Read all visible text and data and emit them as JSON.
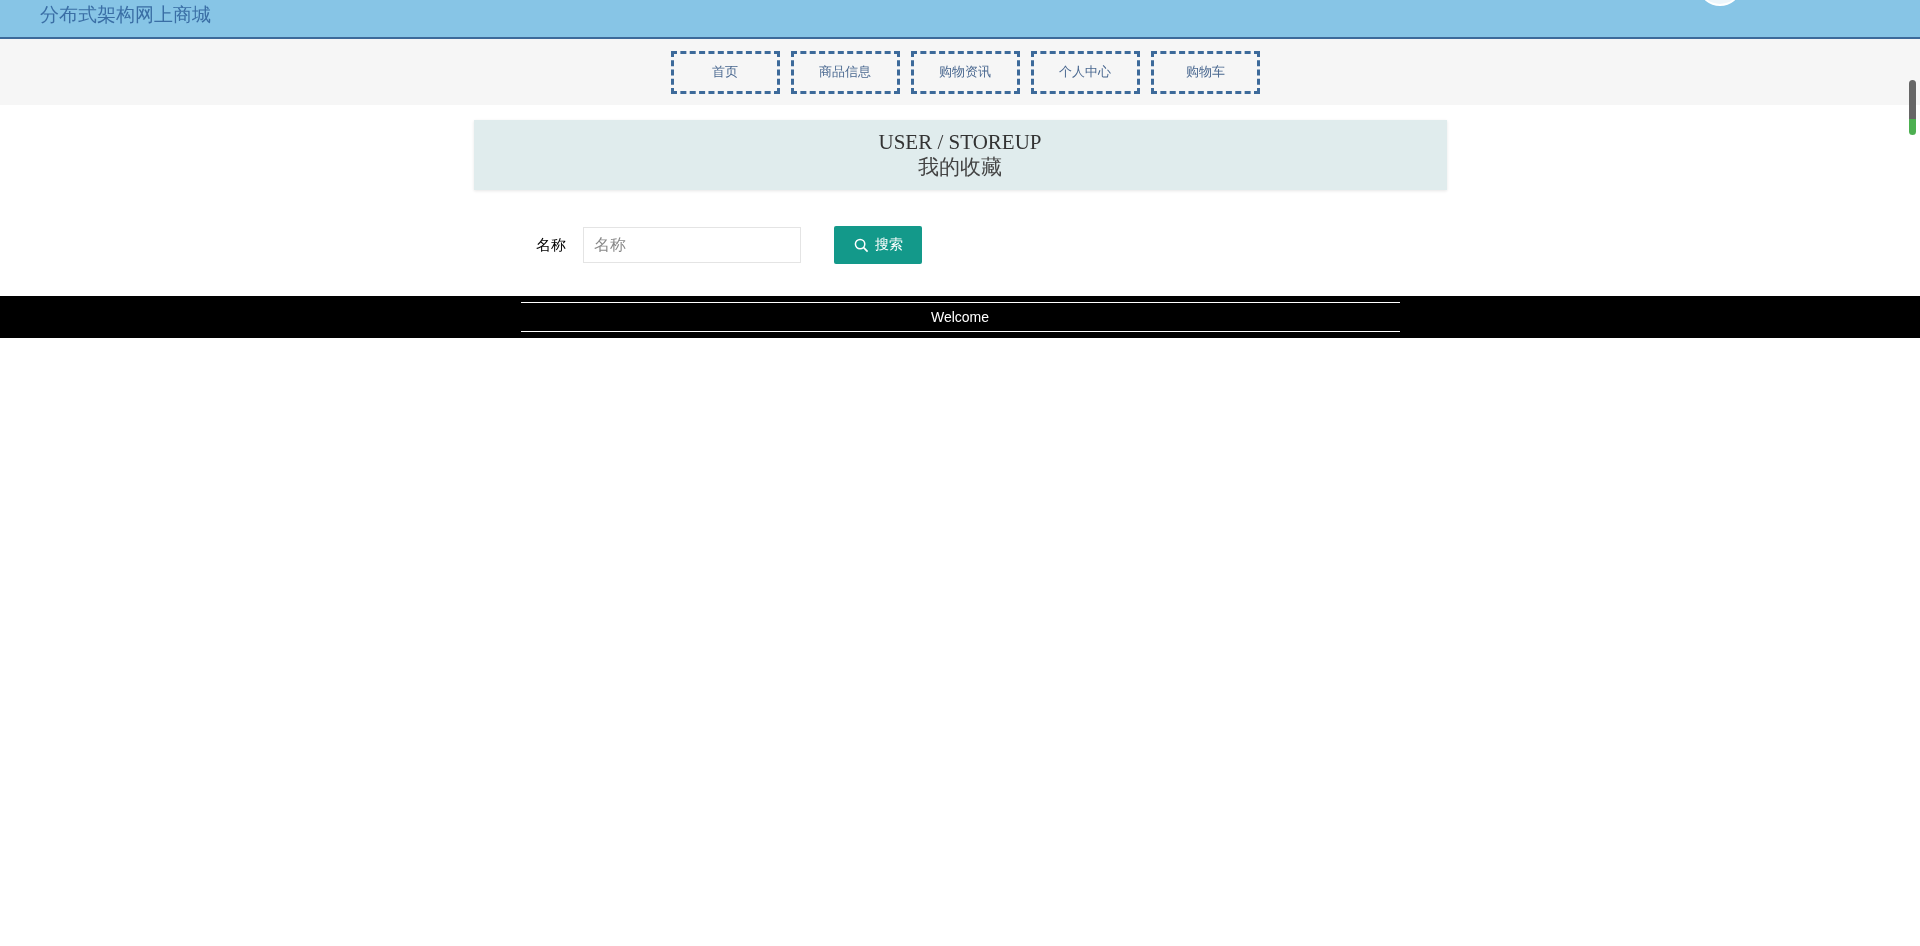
{
  "header": {
    "title": "分布式架构网上商城"
  },
  "nav": {
    "items": [
      "首页",
      "商品信息",
      "购物资讯",
      "个人中心",
      "购物车"
    ]
  },
  "breadcrumb": {
    "english": "USER / STOREUP",
    "title": "我的收藏"
  },
  "search": {
    "label": "名称",
    "placeholder": "名称",
    "button": "搜索"
  },
  "footer": {
    "text": "Welcome"
  }
}
